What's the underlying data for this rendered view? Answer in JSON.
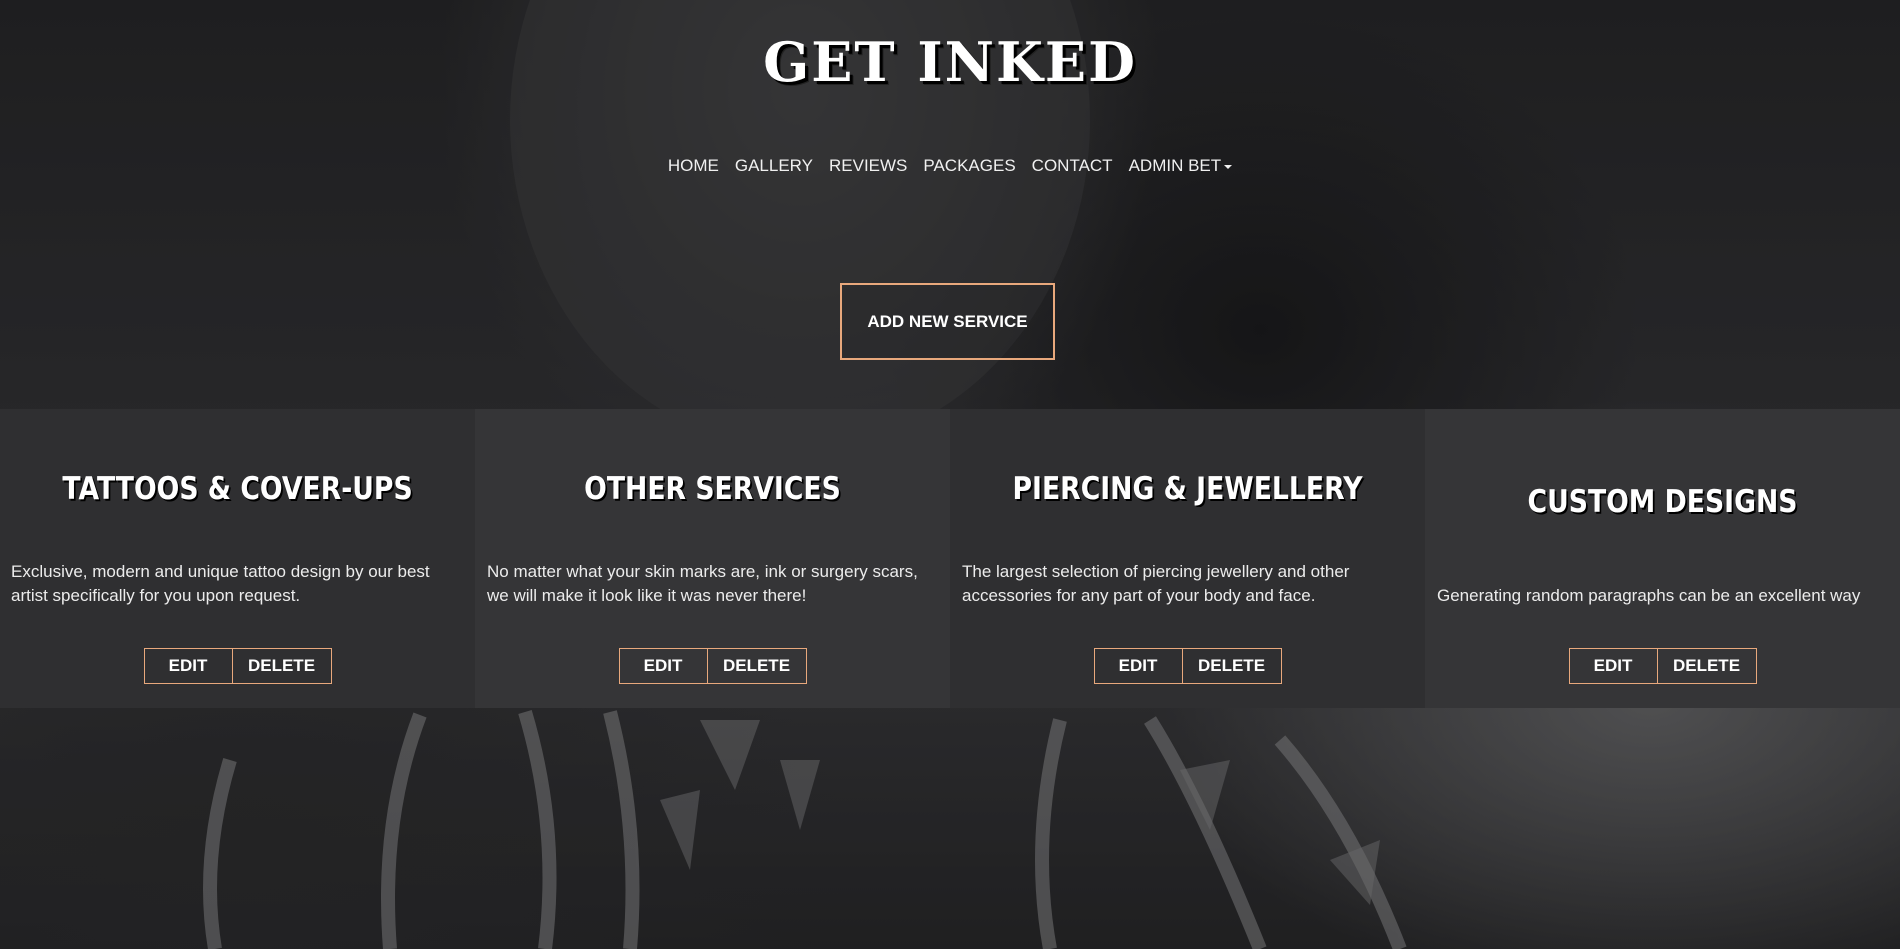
{
  "site": {
    "logo": "GET INKED"
  },
  "nav": {
    "items": [
      {
        "label": "HOME"
      },
      {
        "label": "GALLERY"
      },
      {
        "label": "REVIEWS"
      },
      {
        "label": "PACKAGES"
      },
      {
        "label": "CONTACT"
      },
      {
        "label": "ADMIN BET"
      }
    ]
  },
  "actions": {
    "add_service_label": "ADD NEW SERVICE"
  },
  "services": [
    {
      "title": "TATTOOS & COVER-UPS",
      "description": "Exclusive, modern and unique tattoo design by our best artist specifically for you upon request.",
      "edit_label": "EDIT",
      "delete_label": "DELETE"
    },
    {
      "title": "OTHER SERVICES",
      "description": "No matter what your skin marks are, ink or surgery scars, we will make it look like it was never there!",
      "edit_label": "EDIT",
      "delete_label": "DELETE"
    },
    {
      "title": "PIERCING & JEWELLERY",
      "description": "The largest selection of piercing jewellery and other accessories for any part of your body and face.",
      "edit_label": "EDIT",
      "delete_label": "DELETE"
    },
    {
      "title": "CUSTOM DESIGNS",
      "description": "Generating random paragraphs can be an excellent way",
      "edit_label": "EDIT",
      "delete_label": "DELETE"
    }
  ],
  "colors": {
    "accent": "#e8a87c",
    "card_bg": "#2f2f31",
    "card_bg_alt": "#353537"
  }
}
